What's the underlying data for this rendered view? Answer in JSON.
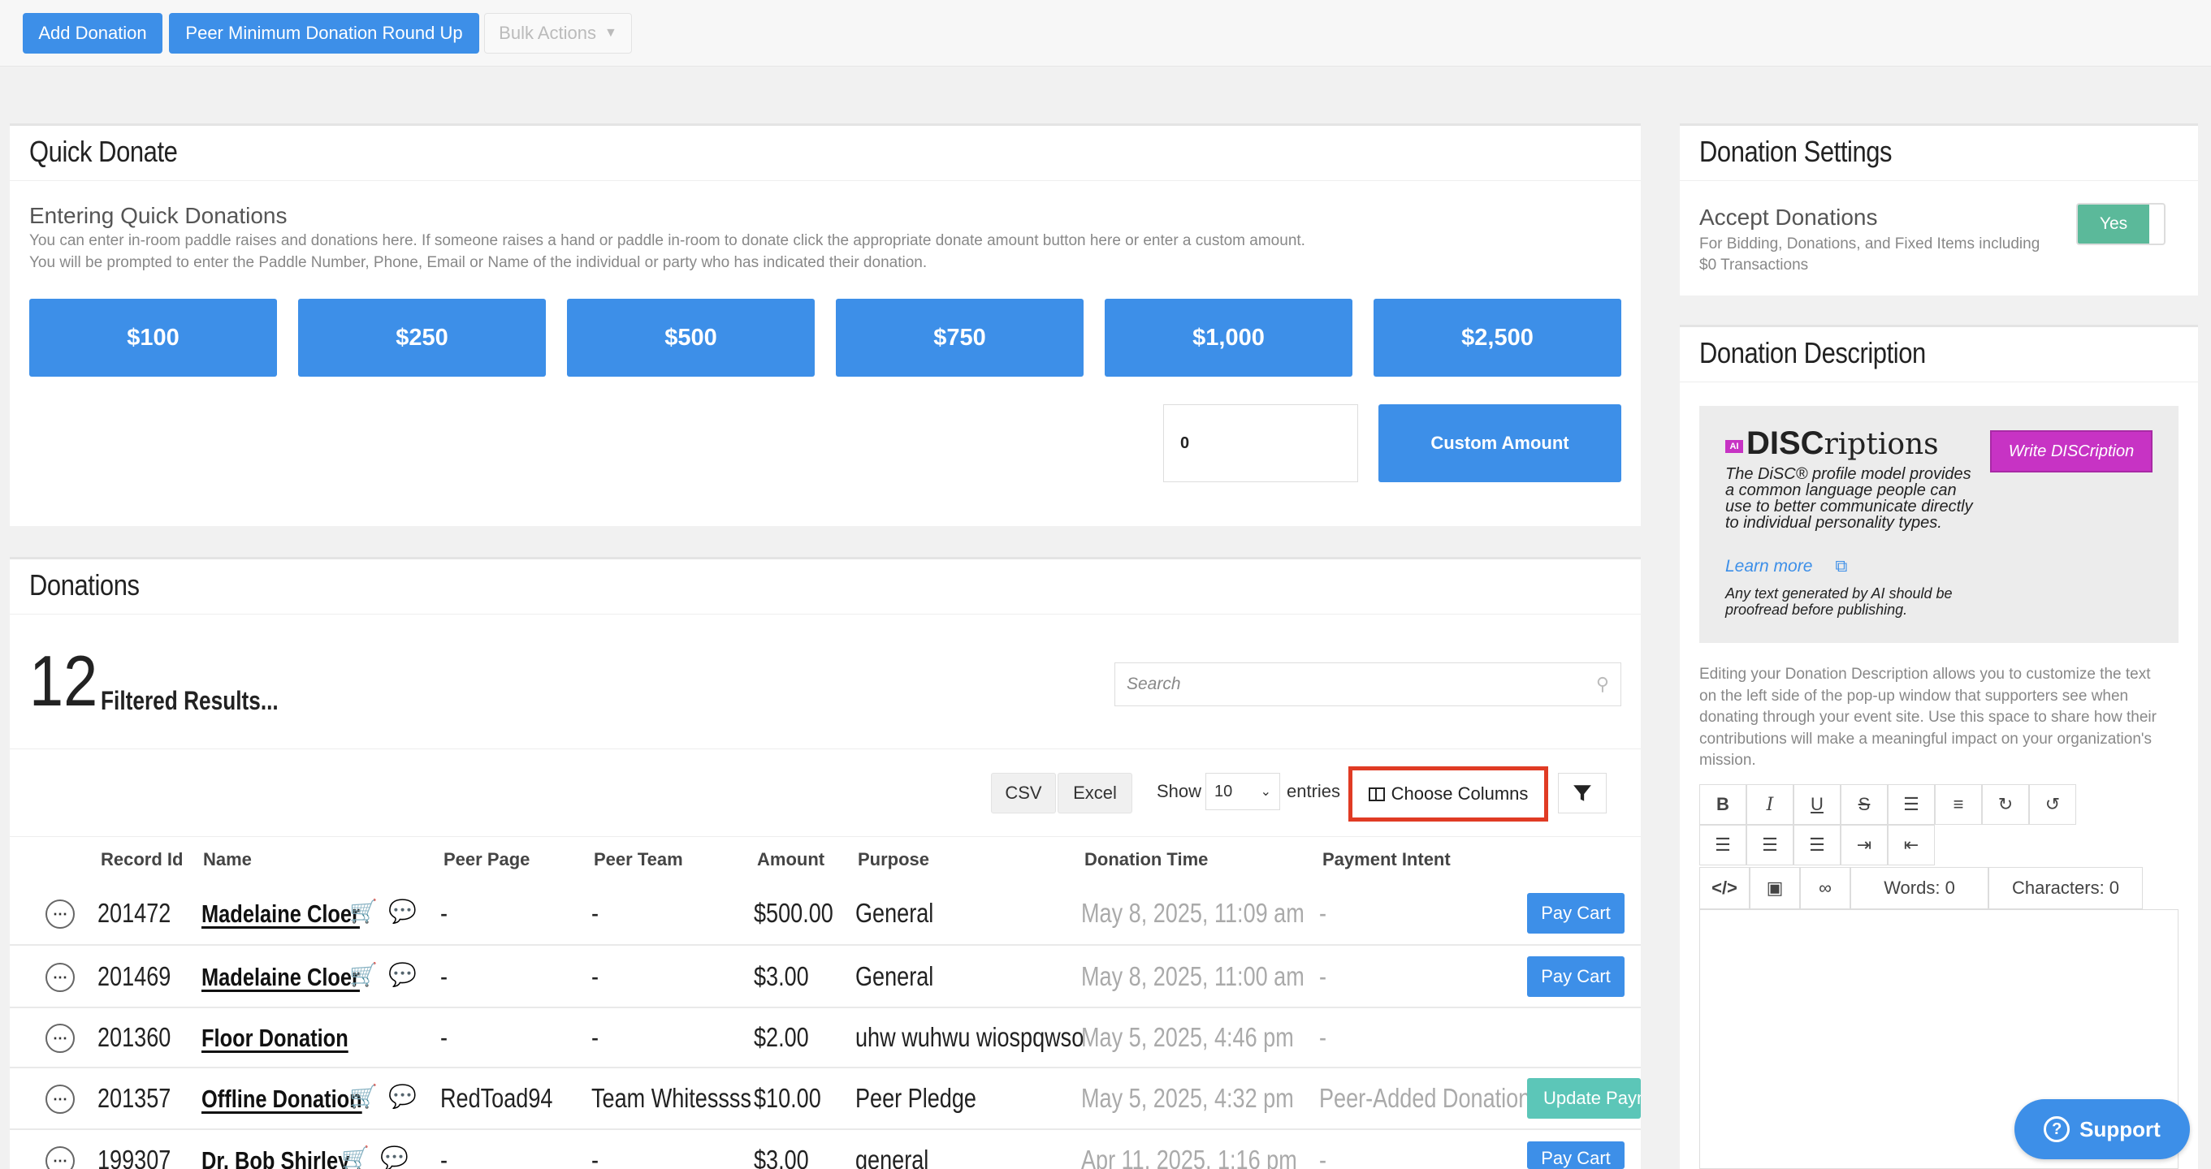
{
  "topbar": {
    "add_donation": "Add Donation",
    "peer_round_up": "Peer Minimum Donation Round Up",
    "bulk_actions": "Bulk Actions"
  },
  "quick_donate": {
    "title": "Quick Donate",
    "subtitle": "Entering Quick Donations",
    "desc1": "You can enter in-room paddle raises and donations here. If someone raises a hand or paddle in-room to donate click the appropriate donate amount button here or enter a custom amount.",
    "desc2": "You will be prompted to enter the Paddle Number, Phone, Email or Name of the individual or party who has indicated their donation.",
    "amounts": [
      "$100",
      "$250",
      "$500",
      "$750",
      "$1,000",
      "$2,500"
    ],
    "custom_value": "0",
    "custom_button": "Custom Amount"
  },
  "donations": {
    "title": "Donations",
    "count": "12",
    "filtered_label": "Filtered Results...",
    "search_placeholder": "Search",
    "csv": "CSV",
    "excel": "Excel",
    "show_label": "Show",
    "show_value": "10",
    "entries_label": "entries",
    "choose_columns": "Choose Columns",
    "columns": [
      "Record Id",
      "Name",
      "Peer Page",
      "Peer Team",
      "Amount",
      "Purpose",
      "Donation Time",
      "Payment Intent"
    ],
    "rows": [
      {
        "id": "201472",
        "name": "Madelaine Cloer",
        "peer_page": "-",
        "peer_team": "-",
        "amount": "$500.00",
        "purpose": "General",
        "time": "May 8, 2025, 11:09 am",
        "intent": "-",
        "action": "Pay Cart"
      },
      {
        "id": "201469",
        "name": "Madelaine Cloer",
        "peer_page": "-",
        "peer_team": "-",
        "amount": "$3.00",
        "purpose": "General",
        "time": "May 8, 2025, 11:00 am",
        "intent": "-",
        "action": "Pay Cart"
      },
      {
        "id": "201360",
        "name": "Floor Donation",
        "peer_page": "-",
        "peer_team": "-",
        "amount": "$2.00",
        "purpose": "uhw wuhwu wiospqwso",
        "time": "May 5, 2025, 4:46 pm",
        "intent": "-",
        "action": ""
      },
      {
        "id": "201357",
        "name": "Offline Donation",
        "peer_page": "RedToad94",
        "peer_team": "Team Whitessss",
        "amount": "$10.00",
        "purpose": "Peer Pledge",
        "time": "May 5, 2025, 4:32 pm",
        "intent": "Peer-Added Donation",
        "action": "Update Payment"
      },
      {
        "id": "199307",
        "name": "Dr. Bob Shirley",
        "peer_page": "-",
        "peer_team": "-",
        "amount": "$3.00",
        "purpose": "general",
        "time": "Apr 11, 2025, 1:16 pm",
        "intent": "-",
        "action": "Pay Cart"
      }
    ]
  },
  "settings": {
    "title": "Donation Settings",
    "accept_label": "Accept Donations",
    "accept_desc1": "For Bidding, Donations, and Fixed Items including",
    "accept_desc2": "$0 Transactions",
    "toggle_value": "Yes"
  },
  "description": {
    "title": "Donation Description",
    "ai_badge": "AI",
    "brand_bold": "DISC",
    "brand_rest": "riptions",
    "write_button": "Write DISCription",
    "blurb": "The DiSC® profile model provides a common language people can use to better communicate directly to individual personality types.",
    "learn_more": "Learn more",
    "ai_note": "Any text generated by AI should be proofread before publishing.",
    "help": "Editing your Donation Description allows you to customize the text on the left side of the pop-up window that supporters see when donating through your event site. Use this space to share how their contributions will make a meaningful impact on your organization's mission.",
    "words": "Words: 0",
    "characters": "Characters: 0"
  },
  "support": {
    "label": "Support"
  }
}
